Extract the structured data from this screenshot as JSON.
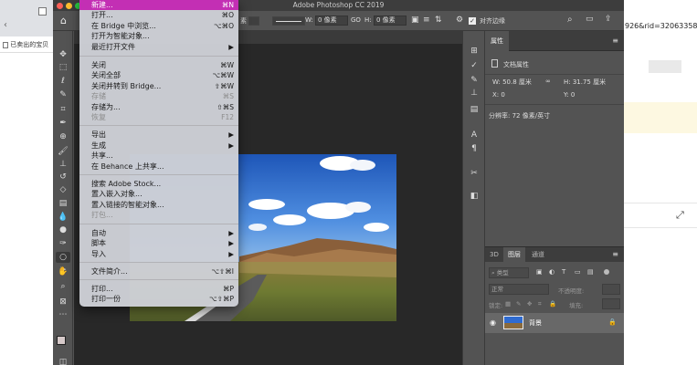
{
  "browser": {
    "bookmark_label": "已卖出的宝贝",
    "url_fragment": "926&rid=32063358"
  },
  "ps": {
    "title": "Adobe Photoshop CC 2019",
    "options": {
      "shape_suffix": "素",
      "w_label": "W:",
      "w_value": "0 像素",
      "go_label": "GO",
      "h_label": "H:",
      "h_value": "0 像素",
      "align_edges": "对齐边缘"
    },
    "menu": {
      "items": [
        {
          "label": "新建...",
          "shortcut": "⌘N",
          "highlighted": true
        },
        {
          "label": "打开...",
          "shortcut": "⌘O"
        },
        {
          "label": "在 Bridge 中浏览...",
          "shortcut": "⌥⌘O"
        },
        {
          "label": "打开为智能对象..."
        },
        {
          "label": "最近打开文件",
          "arrow": "▶"
        },
        {
          "label": "关闭",
          "shortcut": "⌘W"
        },
        {
          "label": "关闭全部",
          "shortcut": "⌥⌘W"
        },
        {
          "label": "关闭并转到 Bridge...",
          "shortcut": "⇧⌘W"
        },
        {
          "label": "存储",
          "shortcut": "⌘S",
          "disabled": true
        },
        {
          "label": "存储为...",
          "shortcut": "⇧⌘S"
        },
        {
          "label": "恢复",
          "shortcut": "F12",
          "disabled": true
        },
        {
          "label": "导出",
          "arrow": "▶"
        },
        {
          "label": "生成",
          "arrow": "▶"
        },
        {
          "label": "共享..."
        },
        {
          "label": "在 Behance 上共享..."
        },
        {
          "label": "搜索 Adobe Stock..."
        },
        {
          "label": "置入嵌入对象..."
        },
        {
          "label": "置入链接的智能对象..."
        },
        {
          "label": "打包...",
          "disabled": true
        },
        {
          "label": "自动",
          "arrow": "▶"
        },
        {
          "label": "脚本",
          "arrow": "▶"
        },
        {
          "label": "导入",
          "arrow": "▶"
        },
        {
          "label": "文件简介...",
          "shortcut": "⌥⇧⌘I"
        },
        {
          "label": "打印...",
          "shortcut": "⌘P"
        },
        {
          "label": "打印一份",
          "shortcut": "⌥⇧⌘P"
        }
      ]
    },
    "properties": {
      "tab": "属性",
      "doc_props": "文档属性",
      "w": "W: 50.8 厘米",
      "h": "H: 31.75 厘米",
      "x": "X: 0",
      "y": "Y: 0",
      "resolution": "分辨率: 72 像素/英寸"
    },
    "layers": {
      "tab_3d": "3D",
      "tab_layers": "图层",
      "tab_channels": "通道",
      "kind": "类型",
      "blend_mode": "正常",
      "opacity": "不透明度:",
      "lock": "锁定:",
      "fill": "填充:",
      "layer_name": "背景"
    },
    "colors": {
      "menu_highlight": "#c32fb4",
      "panel_bg": "#535353",
      "canvas_bg": "#282828"
    }
  }
}
